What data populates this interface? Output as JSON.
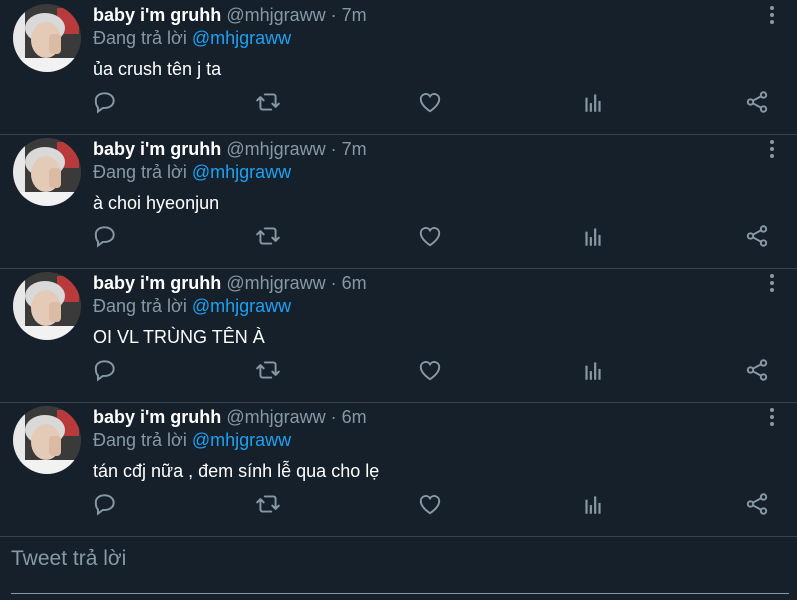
{
  "tweets": [
    {
      "name": "baby i'm gruhh",
      "handle": "@mhjgraww",
      "dot": "·",
      "time": "7m",
      "replying_prefix": "Đang trả lời",
      "replying_to": "@mhjgraww",
      "text": "ủa crush tên j ta"
    },
    {
      "name": "baby i'm gruhh",
      "handle": "@mhjgraww",
      "dot": "·",
      "time": "7m",
      "replying_prefix": "Đang trả lời",
      "replying_to": "@mhjgraww",
      "text": "à choi hyeonjun"
    },
    {
      "name": "baby i'm gruhh",
      "handle": "@mhjgraww",
      "dot": "·",
      "time": "6m",
      "replying_prefix": "Đang trả lời",
      "replying_to": "@mhjgraww",
      "text": "OI VL TRÙNG TÊN À"
    },
    {
      "name": "baby i'm gruhh",
      "handle": "@mhjgraww",
      "dot": "·",
      "time": "6m",
      "replying_prefix": "Đang trả lời",
      "replying_to": "@mhjgraww",
      "text": "tán cđj nữa , đem sính lễ qua cho lẹ"
    }
  ],
  "actions": [
    "reply-icon",
    "retweet-icon",
    "like-icon",
    "analytics-icon",
    "share-icon"
  ],
  "reply_box": {
    "placeholder": "Tweet trả lời"
  },
  "colors": {
    "background": "#15202b",
    "muted": "#8899a6",
    "accent": "#1da1f2",
    "divider": "#38444d"
  }
}
